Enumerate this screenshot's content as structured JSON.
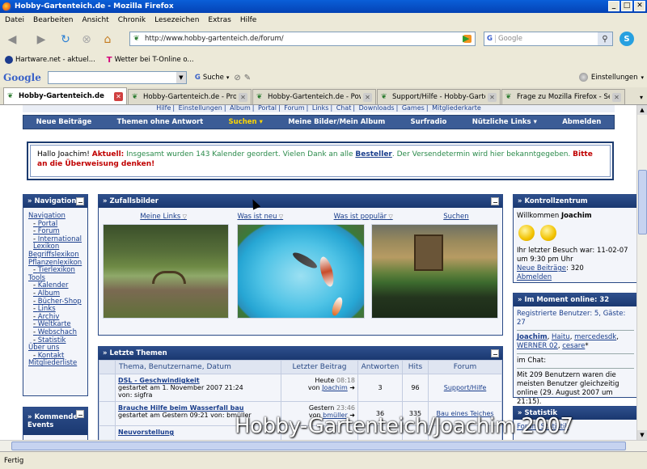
{
  "window": {
    "title": "Hobby-Gartenteich.de - Mozilla Firefox"
  },
  "menu": [
    "Datei",
    "Bearbeiten",
    "Ansicht",
    "Chronik",
    "Lesezeichen",
    "Extras",
    "Hilfe"
  ],
  "url": "http://www.hobby-gartenteich.de/forum/",
  "search": {
    "placeholder": "Google"
  },
  "bookmarks": [
    "Hartware.net - aktuel...",
    "Wetter bei T-Online o..."
  ],
  "google_toolbar": {
    "logo": "Google",
    "search_label": "Suche",
    "settings_label": "Einstellungen"
  },
  "tabs": [
    "Hobby-Gartenteich.de",
    "Hobby-Gartenteich.de - Prof...",
    "Hobby-Gartenteich.de - Pow...",
    "Support/Hilfe - Hobby-Garte...",
    "Frage zu Mozilla Firefox - Sei..."
  ],
  "toplinks": [
    "Hilfe",
    "Einstellungen",
    "Album",
    "Portal",
    "Forum",
    "Links",
    "Chat",
    "Downloads",
    "Games",
    "Mitgliederkarte"
  ],
  "mainnav": [
    "Neue Beiträge",
    "Themen ohne Antwort",
    "Suchen",
    "Meine Bilder/Mein Album",
    "Surfradio",
    "Nützliche Links",
    "Abmelden"
  ],
  "notice": {
    "greeting": "Hallo Joachim!",
    "aktuell": "Aktuell:",
    "text1": "Insgesamt wurden 143 Kalender geordert. Vielen Dank an alle",
    "link": "Besteller",
    "text2": ". Der Versendetermin wird hier bekanntgegeben.",
    "red": "Bitte an die Überweisung denken!"
  },
  "navigation": {
    "title": "» Navigation",
    "items": [
      {
        "label": "Navigation",
        "sub": false
      },
      {
        "label": "Portal",
        "sub": true
      },
      {
        "label": "Forum",
        "sub": true
      },
      {
        "label": "International Lexikon",
        "sub": true
      },
      {
        "label": "Begriffslexikon",
        "sub": false
      },
      {
        "label": "Pflanzenlexikon",
        "sub": false
      },
      {
        "label": "Tierlexikon",
        "sub": true
      },
      {
        "label": "Tools",
        "sub": false
      },
      {
        "label": "Kalender",
        "sub": true
      },
      {
        "label": "Album",
        "sub": true
      },
      {
        "label": "Bücher-Shop",
        "sub": true
      },
      {
        "label": "Links",
        "sub": true
      },
      {
        "label": "Archiv",
        "sub": true
      },
      {
        "label": "Weltkarte",
        "sub": true
      },
      {
        "label": "Webschach",
        "sub": true
      },
      {
        "label": "Statistik",
        "sub": true
      },
      {
        "label": "Über uns",
        "sub": false
      },
      {
        "label": "Kontakt",
        "sub": true
      },
      {
        "label": "Mitgliederliste",
        "sub": false
      }
    ]
  },
  "kommende": {
    "title": "» Kommende Events"
  },
  "zufall": {
    "title": "» Zufallsbilder",
    "tabs": [
      "Meine Links",
      "Was ist neu",
      "Was ist populär",
      "Suchen"
    ]
  },
  "letzte": {
    "title": "» Letzte Themen",
    "headers": [
      "Thema, Benutzername, Datum",
      "Letzter Beitrag",
      "Antworten",
      "Hits",
      "Forum"
    ],
    "rows": [
      {
        "title": "DSL - Geschwindigkeit",
        "started": "gestartet am 1. November 2007 21:24",
        "by": "von: sigfra",
        "last_day": "Heute",
        "last_time": "08:18",
        "last_by_prefix": "von",
        "last_by": "Joachim",
        "answers": "3",
        "hits": "96",
        "forum": "Support/Hilfe"
      },
      {
        "title": "Brauche Hilfe beim Wasserfall bau",
        "started": "gestartet am Gestern 09:21 von: bmüller",
        "by": "",
        "last_day": "Gestern",
        "last_time": "23:46",
        "last_by_prefix": "von",
        "last_by": "bmüller",
        "answers": "36",
        "hits": "335",
        "forum": "Bau eines Teiches"
      },
      {
        "title": "Neuvorstellung",
        "started": "",
        "by": "",
        "last_day": "",
        "last_time": "",
        "last_by_prefix": "",
        "last_by": "",
        "answers": "",
        "hits": "",
        "forum": ""
      }
    ]
  },
  "kontroll": {
    "title": "» Kontrollzentrum",
    "welcome_prefix": "Willkommen",
    "user": "Joachim",
    "last_visit": "Ihr letzter Besuch war: 11-02-07 um 9:30 pm Uhr",
    "new_posts": "Neue Beiträge",
    "new_posts_count": ": 320",
    "logout": "Abmelden"
  },
  "online": {
    "title": "» Im Moment online: 32",
    "registered": "Registrierte Benutzer: 5, Gäste: 27",
    "users": [
      "Joachim",
      "Haitu",
      "mercedesdk",
      "WERNER 02",
      "cesare"
    ],
    "chat": "im Chat:",
    "record": "Mit 209 Benutzern waren die meisten Benutzer gleichzeitig online (29. August 2007 um 21:15)."
  },
  "statistik": {
    "title": "» Statistik",
    "link": "Forum Statistik"
  },
  "status": "Fertig",
  "watermark": "Hobby-Gartenteich/Joachim 2007"
}
